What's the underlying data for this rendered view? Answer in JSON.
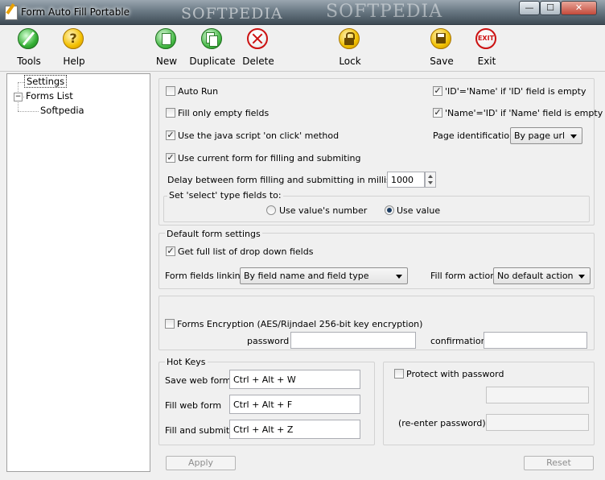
{
  "window": {
    "title": "Form Auto Fill Portable",
    "watermark_left": "SOFTPEDIA",
    "watermark_right": "SOFTPEDIA",
    "min_glyph": "—",
    "max_glyph": "☐",
    "close_glyph": "✕"
  },
  "toolbar": {
    "tools": "Tools",
    "help": "Help",
    "new": "New",
    "duplicate": "Duplicate",
    "delete": "Delete",
    "lock": "Lock",
    "save": "Save",
    "exit": "Exit",
    "exit_icon_text": "EXIT",
    "help_icon_text": "?"
  },
  "tree": {
    "settings": "Settings",
    "forms_list": "Forms List",
    "softpedia": "Softpedia",
    "expander": "−"
  },
  "settings": {
    "auto_run": {
      "label": "Auto Run",
      "checked": false
    },
    "fill_only_empty": {
      "label": "Fill only empty fields",
      "checked": false
    },
    "use_javascript": {
      "label": "Use the java script 'on click' method",
      "checked": true
    },
    "use_current_form": {
      "label": "Use current form for filling and submiting",
      "checked": true
    },
    "id_name": {
      "label": "'ID'='Name' if 'ID' field is empty",
      "checked": true
    },
    "name_id": {
      "label": "'Name'='ID' if 'Name' field is empty",
      "checked": true
    },
    "page_identification_label": "Page identification",
    "page_identification_value": "By page url",
    "delay_label": "Delay between form filling and submitting in milliseconds",
    "delay_value": "1000",
    "select_fields_label": "Set 'select' type fields to:",
    "radio_number": {
      "label": "Use value's number",
      "selected": false
    },
    "radio_value": {
      "label": "Use value",
      "selected": true
    },
    "check_glyph": "✓"
  },
  "defaults": {
    "title": "Default form settings",
    "full_list": {
      "label": "Get full list of drop down fields",
      "checked": true
    },
    "linking_label": "Form fields linking",
    "linking_value": "By field name and field type",
    "fill_action_label": "Fill form action",
    "fill_action_value": "No default action"
  },
  "encryption": {
    "label": "Forms Encryption (AES/Rijndael 256-bit key encryption)",
    "checked": false,
    "password_label": "password",
    "password_value": "",
    "confirmation_label": "confirmation",
    "confirmation_value": ""
  },
  "hotkeys": {
    "title": "Hot Keys",
    "save_label": "Save web form",
    "save_value": "Ctrl + Alt + W",
    "fill_label": "Fill web form",
    "fill_value": "Ctrl + Alt + F",
    "submit_label": "Fill and submit",
    "submit_value": "Ctrl + Alt + Z"
  },
  "protect": {
    "label": "Protect with password",
    "checked": false,
    "reenter_label": "(re-enter password)",
    "password_value": "",
    "reenter_value": ""
  },
  "footer": {
    "apply": "Apply",
    "reset": "Reset"
  },
  "colors": {
    "accent_green": "#2f9e2f",
    "help_yellow": "#f0b400",
    "delete_red": "#cc1111",
    "lock_gold": "#e4a800"
  }
}
